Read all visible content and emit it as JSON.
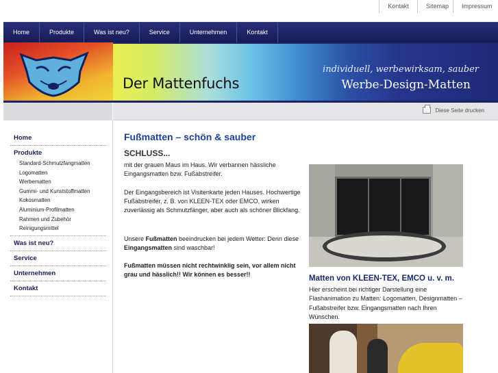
{
  "top_links": [
    "Kontakt",
    "Sitemap",
    "Impressum"
  ],
  "main_nav": [
    "Home",
    "Produkte",
    "Was ist neu?",
    "Service",
    "Unternehmen",
    "Kontakt"
  ],
  "banner": {
    "brand": "Der Mattenfuchs",
    "tagline1": "individuell, werbewirksam, sauber",
    "tagline2": "Werbe-Design-Matten"
  },
  "print_link": "Diese Seite drucken",
  "sidebar": {
    "home": "Home",
    "produkte": "Produkte",
    "sub": [
      "Standard-Schmutzfangmatten",
      "Logomatten",
      "Werbematten",
      "Gummi- und Kunststoffmatten",
      "Kokosmatten",
      "Aluminium-Profilmatten",
      "Rahmen und Zubehör",
      "Reinigungsmittel"
    ],
    "was_ist_neu": "Was ist neu?",
    "service": "Service",
    "unternehmen": "Unternehmen",
    "kontakt": "Kontakt"
  },
  "content": {
    "title": "Fußmatten – schön & sauber",
    "subtitle": "SCHLUSS...",
    "p1": "mit der grauen Maus im Haus. Wir verbannen hässliche Eingangsmatten bzw. Fußabstreifer.",
    "p2": "Der Eingangsbereich ist Visitenkarte jeden Hauses. Hochwertige Fußabstreifer, z. B. von KLEEN-TEX oder EMCO, wirken zuverlässig als Schmutzfänger, aber auch als schöner Blickfang.",
    "p3_a": "Unsere ",
    "p3_b": "Fußmatten",
    "p3_c": " beeindrucken bei jedem Wetter: Denn diese ",
    "p3_d": "Eingangsmatten",
    "p3_e": " sind waschbar!",
    "p4": "Fußmatten müssen nicht rechtwinklig sein, vor allem nicht grau und hässlich!! Wir können es besser!!",
    "right_title": "Matten von KLEEN-TEX, EMCO u. v. m.",
    "right_text": "Hier erscheint bei richtiger Darstellung eine Flashanimation zu Matten: Logomatten, Designmatten – Fußabstreifer bzw. Eingangsmatten nach Ihren Wünschen."
  }
}
